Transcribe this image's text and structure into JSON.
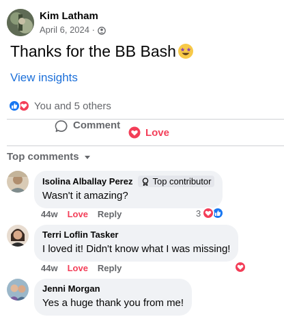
{
  "post": {
    "author": "Kim Latham",
    "date": "April 6, 2024 ·",
    "text": "Thanks for the BB Bash",
    "insights_label": "View insights",
    "reactions_text": "You and 5 others"
  },
  "actions": {
    "love_label": "Love",
    "comment_label": "Comment"
  },
  "comments_header": "Top comments",
  "comments": [
    {
      "name": "Isolina Alballay Perez",
      "badge": "Top contributor",
      "text": "Wasn't it amazing?",
      "time": "44w",
      "love": "Love",
      "reply": "Reply",
      "reaction_count": "3"
    },
    {
      "name": "Terri Loflin Tasker",
      "text": "I loved it! Didn't know what I was missing!",
      "time": "44w",
      "love": "Love",
      "reply": "Reply"
    },
    {
      "name": "Jenni Morgan",
      "text": "Yes a huge thank you from me!"
    }
  ],
  "colors": {
    "love": "#f33e58",
    "like": "#1877f2",
    "link": "#1b6fd9",
    "secondary_text": "#65676b",
    "bubble": "#f0f2f5"
  },
  "icons": [
    "globe-icon",
    "star-struck-emoji",
    "like-reaction-icon",
    "love-reaction-icon",
    "heart-icon",
    "comment-bubble-icon",
    "caret-down-icon",
    "badge-icon"
  ]
}
